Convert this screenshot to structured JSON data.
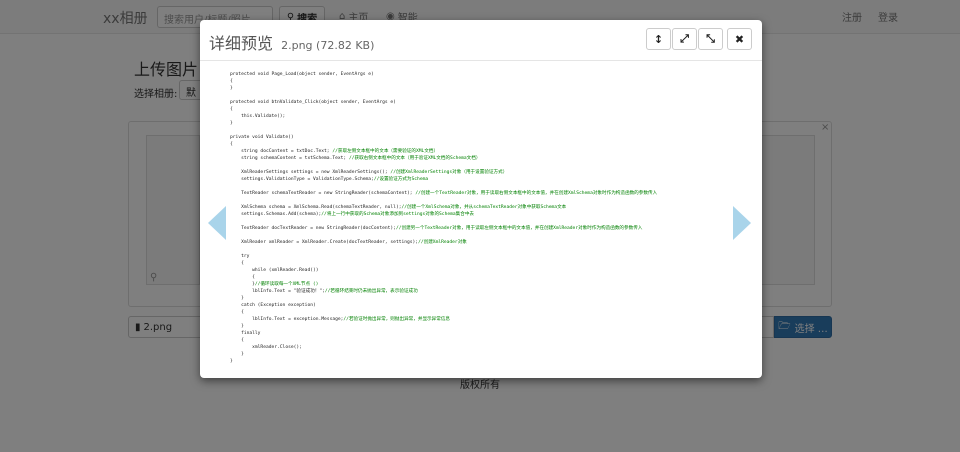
{
  "navbar": {
    "brand": "xx相册",
    "search_placeholder": "搜索用户/标题/照片",
    "search_label": "搜索",
    "home_label": "主页",
    "about_label": "智能",
    "register_label": "注册",
    "login_label": "登录"
  },
  "page": {
    "heading": "上传图片",
    "album_label": "选择相册:",
    "album_selected": "默",
    "remove_glyph": "×"
  },
  "file_input": {
    "caption": "2.png",
    "browse_label": "选择 …"
  },
  "footer": {
    "text": "版权所有"
  },
  "modal": {
    "title": "详细预览",
    "file_info": "2.png (72.82 KB)",
    "buttons": [
      {
        "name": "toggle-header",
        "glyph": "↕"
      },
      {
        "name": "fullscreen",
        "glyph": "⤢"
      },
      {
        "name": "borderless",
        "glyph": "⤡"
      },
      {
        "name": "close",
        "glyph": "✖"
      }
    ]
  },
  "colors": {
    "primary": "#337ab7",
    "arrow": "#a9d4ea",
    "backdrop": "#000000"
  },
  "code_lines": [
    "protected void Page_Load(object sender, EventArgs e)",
    "{",
    "}",
    "",
    "protected void btnValidate_Click(object sender, EventArgs e)",
    "{",
    "    this.Validate();",
    "}",
    "",
    "private void Validate()",
    "{",
    "    string docContent = txtDoc.Text; //获取左侧文本框中的文本（需要验证的XML文档）",
    "    string schemaContent = txtSchema.Text; //获取右侧文本框中的文本（用于验证XML文档的Schema文档）",
    "",
    "    XmlReaderSettings settings = new XmlReaderSettings(); //创建XmlReaderSettings对象（用于设置验证方式）",
    "    settings.ValidationType = ValidationType.Schema;//设置验证方式为Schema",
    "",
    "    TextReader schemaTextReader = new StringReader(schemaContent); //创建一个TextReader对象，用于读取右侧文本框中的文本值，并在创建XmlSchema对象时作为构造函数的参数传入",
    "",
    "    XmlSchema schema = XmlSchema.Read(schemaTextReader, null);//创建一个XmlSchema对象，并从schemaTextReader对象中获取Schema文本",
    "    settings.Schemas.Add(schema);//将上一行中获取的Schema对象添加到settings对象的Schema集合中去",
    "",
    "    TextReader docTextReader = new StringReader(docContent);//创建另一个TextReader对象，用于读取左侧文本框中的文本值，并在创建XmlReader对象时作为构造函数的参数传入",
    "",
    "    XmlReader xmlReader = XmlReader.Create(docTextReader, settings);//创建XmlReader对象",
    "",
    "    try",
    "    {",
    "        while (xmlReader.Read())",
    "        {",
    "        }//循环读取每一个XML节点 ()",
    "        lblInfo.Text = \"验证成功！\";//若循环结束时仍未抛出异常，表示验证成功",
    "    }",
    "    catch (Exception exception)",
    "    {",
    "        lblInfo.Text = exception.Message;//若验证时抛出异常，则抛出异常，并显示异常信息",
    "    }",
    "    finally",
    "    {",
    "        xmlReader.Close();",
    "    }",
    "}"
  ]
}
